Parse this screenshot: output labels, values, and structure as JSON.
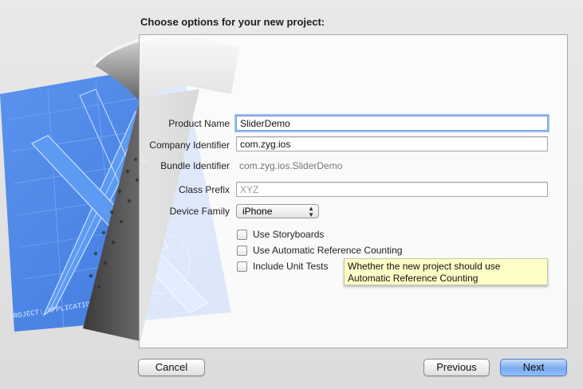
{
  "window": {
    "heading": "Choose options for your new project:"
  },
  "form": {
    "product_name": {
      "label": "Product Name",
      "value": "SliderDemo"
    },
    "company_identifier": {
      "label": "Company Identifier",
      "value": "com.zyg.ios"
    },
    "bundle_identifier": {
      "label": "Bundle Identifier",
      "value": "com.zyg.ios.SliderDemo"
    },
    "class_prefix": {
      "label": "Class Prefix",
      "placeholder": "XYZ"
    },
    "device_family": {
      "label": "Device Family",
      "value": "iPhone"
    },
    "options": [
      {
        "label": "Use Storyboards",
        "checked": false
      },
      {
        "label": "Use Automatic Reference Counting",
        "checked": false
      },
      {
        "label": "Include Unit Tests",
        "checked": false
      }
    ]
  },
  "tooltip": {
    "text": "Whether the new project should use Automatic Reference Counting"
  },
  "artwork": {
    "blueprint_text": "PROJECT: APPLICATION.APP"
  },
  "buttons": {
    "cancel": "Cancel",
    "previous": "Previous",
    "next": "Next"
  },
  "colors": {
    "accent": "#7aaaf0",
    "tooltip_bg": "#fdfdc8",
    "blueprint": "#4f86e6"
  }
}
